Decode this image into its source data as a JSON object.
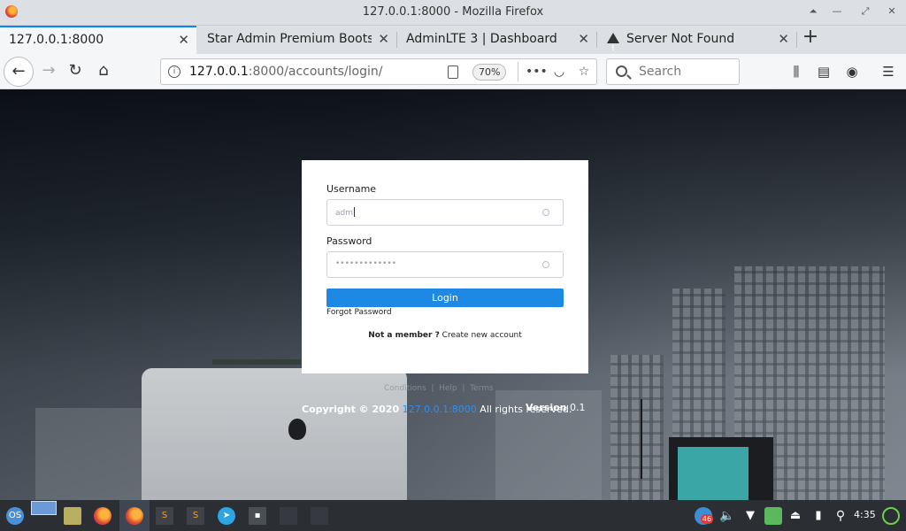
{
  "window": {
    "title": "127.0.0.1:8000 - Mozilla Firefox"
  },
  "tabs": [
    {
      "label": "127.0.0.1:8000",
      "active": true
    },
    {
      "label": "Star Admin Premium Bootst",
      "active": false
    },
    {
      "label": "AdminLTE 3 | Dashboard",
      "active": false
    },
    {
      "label": "Server Not Found",
      "active": false
    }
  ],
  "navbar": {
    "url_host": "127.0.0.1",
    "url_rest": ":8000/accounts/login/",
    "zoom": "70%",
    "search_placeholder": "Search"
  },
  "login": {
    "username_label": "Username",
    "username_value": "adm",
    "password_label": "Password",
    "password_value": "•••••••••••••",
    "login_button": "Login",
    "forgot_link": "Forgot Password",
    "member_prompt": "Not a member ?",
    "create_account_link": "Create new account"
  },
  "footer": {
    "links": [
      "Conditions",
      "Help",
      "Terms"
    ],
    "copyright_prefix": "Copyright © 2020",
    "copyright_link": "127.0.0.1:8000",
    "copyright_suffix": "All rights reserved.",
    "version_label": "Version",
    "version_value": "0.1"
  },
  "taskbar": {
    "clock": "4:35",
    "badge": "46"
  },
  "colors": {
    "accent": "#1e88e5",
    "link": "#2c8ff5",
    "tab_highlight": "#0a84ff",
    "taskbar": "#2b2e33"
  }
}
